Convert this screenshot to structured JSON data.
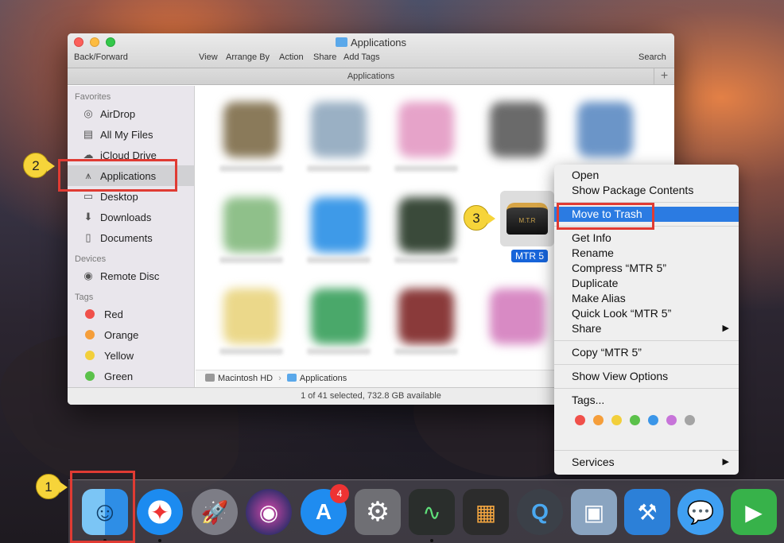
{
  "window": {
    "title": "Applications",
    "toolbar": {
      "back_forward": "Back/Forward",
      "view": "View",
      "arrange_by": "Arrange By",
      "action": "Action",
      "share": "Share",
      "add_tags": "Add Tags",
      "search": "Search"
    },
    "path_tab": "Applications",
    "tab_plus": "+"
  },
  "sidebar": {
    "favorites_header": "Favorites",
    "favorites": [
      {
        "label": "AirDrop",
        "icon": "airdrop-icon"
      },
      {
        "label": "All My Files",
        "icon": "all-files-icon"
      },
      {
        "label": "iCloud Drive",
        "icon": "cloud-icon"
      },
      {
        "label": "Applications",
        "icon": "applications-icon"
      },
      {
        "label": "Desktop",
        "icon": "desktop-icon"
      },
      {
        "label": "Downloads",
        "icon": "downloads-icon"
      },
      {
        "label": "Documents",
        "icon": "documents-icon"
      }
    ],
    "devices_header": "Devices",
    "devices": [
      {
        "label": "Remote Disc",
        "icon": "disc-icon"
      }
    ],
    "tags_header": "Tags",
    "tags": [
      {
        "label": "Red",
        "color": "#f0504a"
      },
      {
        "label": "Orange",
        "color": "#f59e3a"
      },
      {
        "label": "Yellow",
        "color": "#f2cf3b"
      },
      {
        "label": "Green",
        "color": "#5bc14a"
      }
    ]
  },
  "content": {
    "selected_app": "MTR 5",
    "mtr_icon_text": "M.T.R",
    "pathbar": {
      "disk": "Macintosh HD",
      "folder": "Applications"
    },
    "status": "1 of 41 selected, 732.8 GB available"
  },
  "context_menu": {
    "open": "Open",
    "show_package_contents": "Show Package Contents",
    "move_to_trash": "Move to Trash",
    "get_info": "Get Info",
    "rename": "Rename",
    "compress": "Compress “MTR 5”",
    "duplicate": "Duplicate",
    "make_alias": "Make Alias",
    "quick_look": "Quick Look “MTR 5”",
    "share": "Share",
    "copy": "Copy “MTR 5”",
    "show_view_options": "Show View Options",
    "tags": "Tags...",
    "services": "Services",
    "submenu_arrow": "▶",
    "tag_colors": [
      "#f0504a",
      "#f59e3a",
      "#f2cf3b",
      "#5bc14a",
      "#3b96e8",
      "#c774d9",
      "#a4a4a4"
    ]
  },
  "annotations": {
    "step1": "1",
    "step2": "2",
    "step3": "3"
  },
  "dock": {
    "apps": [
      {
        "name": "finder-icon",
        "color": "#2e8ee6",
        "glyph": "☺"
      },
      {
        "name": "safari-icon",
        "color": "#1c8bf0",
        "glyph": "✦"
      },
      {
        "name": "launchpad-icon",
        "color": "#7d7d86",
        "glyph": "🚀"
      },
      {
        "name": "siri-icon",
        "color": "#3a2f6f",
        "glyph": "◉"
      },
      {
        "name": "app-store-icon",
        "color": "#1f8cf0",
        "glyph": "A"
      },
      {
        "name": "system-preferences-icon",
        "color": "#6f6f74",
        "glyph": "⚙"
      },
      {
        "name": "activity-monitor-icon",
        "color": "#2a2e2c",
        "glyph": "∿"
      },
      {
        "name": "photo-booth-icon",
        "color": "#2c6a3a",
        "glyph": "▦"
      },
      {
        "name": "quicktime-icon",
        "color": "#3b4048",
        "glyph": "Q"
      },
      {
        "name": "preview-icon",
        "color": "#8aa4c0",
        "glyph": "▣"
      },
      {
        "name": "xcode-icon",
        "color": "#2c80d8",
        "glyph": "⚒"
      },
      {
        "name": "messages-icon",
        "color": "#3f9ff2",
        "glyph": "💬"
      },
      {
        "name": "facetime-icon",
        "color": "#37b24a",
        "glyph": "▶"
      }
    ],
    "app_store_badge": "4"
  }
}
